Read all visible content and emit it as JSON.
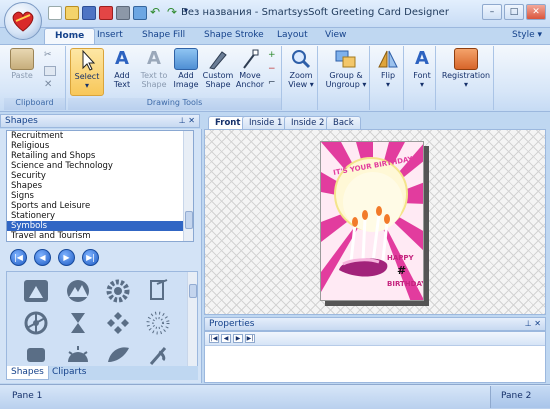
{
  "app": {
    "title": "Без названия - SmartsysSoft Greeting Card Designer"
  },
  "quick_access": [
    "new-icon",
    "open-icon",
    "save-icon",
    "pdf-icon",
    "print-icon",
    "image-icon",
    "undo-icon",
    "redo-icon"
  ],
  "window_buttons": {
    "minimize": "–",
    "maximize": "□",
    "close": "✕"
  },
  "tabs": [
    "Home",
    "Insert",
    "Shape Fill",
    "Shape Stroke",
    "Layout",
    "View"
  ],
  "style_menu": "Style ▾",
  "ribbon": {
    "clipboard": {
      "paste": "Paste",
      "group_label": "Clipboard"
    },
    "drawing": {
      "select": "Select",
      "add_text": "Add\nText",
      "text_to_shape": "Text to\nShape",
      "add_image": "Add\nImage",
      "custom_shape": "Custom\nShape",
      "move_anchor": "Move\nAnchor",
      "group_label": "Drawing Tools"
    },
    "zoom_view": "Zoom\nView",
    "group_ungroup": "Group &\nUngroup",
    "flip": "Flip",
    "font": "Font",
    "registration": "Registration"
  },
  "shapes_pane": {
    "title": "Shapes",
    "categories": [
      "Recruitment",
      "Religious",
      "Retailing and Shops",
      "Science and Technology",
      "Security",
      "Shapes",
      "Signs",
      "Sports and Leisure",
      "Stationery",
      "Symbols",
      "Travel and Tourism"
    ],
    "selected": "Symbols",
    "nav": [
      "|◀",
      "◀",
      "▶",
      "▶|"
    ],
    "icons": [
      "pie-symbol-icon",
      "mountain-circle-icon",
      "gear-icon",
      "hammer-pin-icon",
      "biohazard-icon",
      "hourglass-icon",
      "diamond-cluster-icon",
      "dotted-circle-icon",
      "hand-icon",
      "sunrise-icon",
      "leaf-icon",
      "feather-icon"
    ],
    "bottom_tabs": [
      "Shapes",
      "Cliparts"
    ]
  },
  "document": {
    "page_tabs": [
      "Front",
      "Inside 1",
      "Inside 2",
      "Back"
    ],
    "active_tab": "Front",
    "card": {
      "headline": "IT'S YOUR BIRTHDAY",
      "line1": "HAPPY",
      "line2": "#",
      "line3": "BIRTHDAY"
    }
  },
  "properties": {
    "title": "Properties",
    "toolbar": [
      "|◀",
      "◀",
      "▶",
      "▶|"
    ]
  },
  "status": {
    "left": "Pane 1",
    "right": "Pane 2"
  },
  "colors": {
    "accent": "#15428b",
    "selection": "#3166c4",
    "card_pink": "#e23c9e"
  }
}
